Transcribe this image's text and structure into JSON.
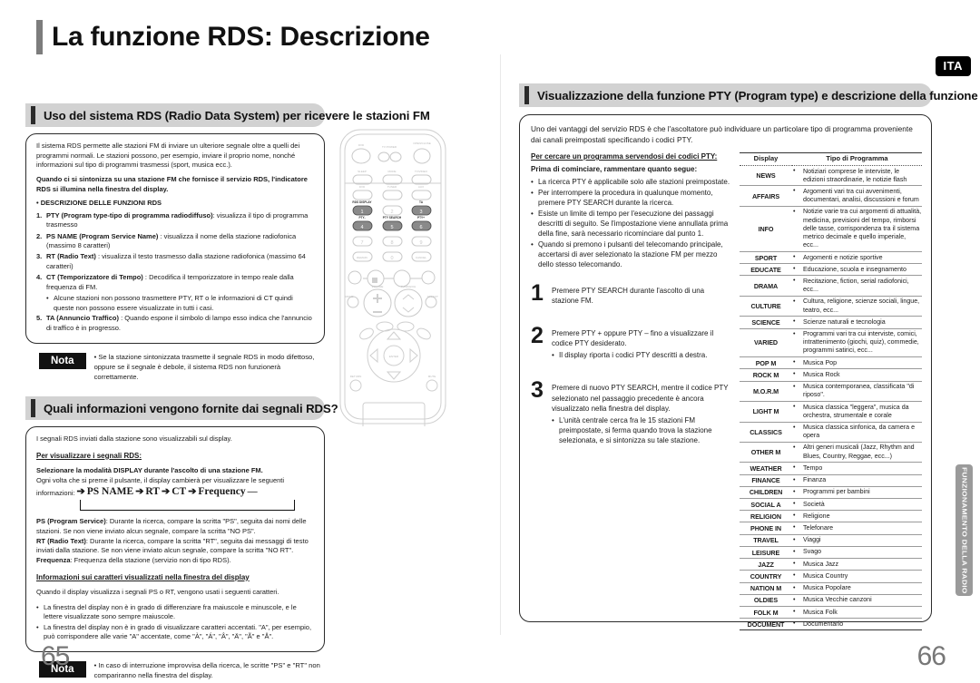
{
  "page": {
    "title": "La funzione RDS: Descrizione",
    "lang_badge": "ITA",
    "side_tab": "FUNZIONAMENTO DELLA RADIO",
    "page_number_left": "65",
    "page_number_right": "66"
  },
  "left": {
    "section1": {
      "heading": "Uso del sistema RDS (Radio Data System) per ricevere le stazioni FM",
      "intro": "Il sistema RDS permette alle stazioni FM di inviare un ulteriore segnale oltre a quelli dei programmi normali. Le stazioni possono, per esempio, inviare il proprio nome, nonché informazioni sul tipo di programmi trasmessi (sport, musica ecc.).",
      "bold_note": "Quando ci si sintonizza su una stazione FM che fornisce il servizio RDS, l'indicatore RDS si illumina nella finestra del display.",
      "list_title": "• DESCRIZIONE DELLE FUNZIONI RDS",
      "items": [
        {
          "n": "1.",
          "bold": "PTY (Program type-tipo di programma radiodiffuso)",
          "rest": ": visualizza il tipo di programma trasmesso"
        },
        {
          "n": "2.",
          "bold": "PS NAME (Program Service Name)",
          "rest": " : visualizza il nome della stazione radiofonica (massimo 8 caratteri)"
        },
        {
          "n": "3.",
          "bold": "RT (Radio Text)",
          "rest": " : visualizza il testo trasmesso dalla stazione radiofonica (massimo 64 caratteri)"
        },
        {
          "n": "4.",
          "bold": "CT (Temporizzatore di Tempo)",
          "rest": " : Decodifica il temporizzatore in tempo reale dalla frequenza di FM."
        }
      ],
      "sub_item": "Alcune stazioni non possono trasmettere PTY, RT o le informazioni di CT quindi queste non possono essere visualizzate in tutti i casi.",
      "item5": {
        "n": "5.",
        "bold": "TA (Annuncio Traffico)",
        "rest": " : Quando espone il simbolo di lampo esso indica che l'annuncio di traffico è in progresso."
      },
      "nota_label": "Nota",
      "nota_text": "• Se la stazione sintonizzata trasmette il segnale RDS in modo difettoso, oppure se il segnale è debole, il sistema RDS non funzionerà correttamente."
    },
    "section2": {
      "heading": "Quali informazioni vengono fornite dai segnali RDS?",
      "intro": "I segnali RDS inviati dalla stazione sono visualizzabili sul display.",
      "sub_heading": "Per visualizzare i segnali RDS:",
      "bold_line": "Selezionare la modalità DISPLAY durante l'ascolto di una stazione FM.",
      "line2": "Ogni volta che si preme il pulsante,  il display cambierà per visualizzare le seguenti",
      "line3": "informazioni:",
      "flow": [
        "PS NAME",
        "RT",
        "CT",
        "Frequency"
      ],
      "defs": [
        {
          "bold": "PS (Program Service)",
          "rest": ": Durante la ricerca, compare la scritta \"PS\", seguita dai nomi delle stazioni. Se non viene inviato alcun segnale, compare la scritta \"NO PS\"."
        },
        {
          "bold": "RT (Radio Text)",
          "rest": ": Durante la ricerca, compare la scritta \"RT\", seguita dai messaggi di testo inviati dalla stazione. Se non viene inviato alcun segnale, compare la scritta \"NO RT\"."
        },
        {
          "bold": "Frequenza",
          "rest": ": Frequenza della stazione (servizio non di tipo RDS)."
        }
      ],
      "chars_heading": "Informazioni sui caratteri visualizzati nella finestra del display",
      "chars_intro": "Quando il display visualizza i segnali PS o RT, vengono usati i seguenti caratteri.",
      "chars_bullets": [
        "La finestra del display non è in grado di differenziare fra maiuscole e minuscole, e le lettere visualizzate sono sempre maiuscole.",
        "La finestra del display non è in grado di visualizzare caratteri accentati. \"A\", per esempio, può corrispondere alle varie \"A\" accentate, come \"À\", \"Á\", \"Â\", \"Ä\", \"Ã\" e \"Å\"."
      ],
      "nota_label": "Nota",
      "nota_text": "• In caso di interruzione improvvisa della ricerca, le scritte \"PS\" e \"RT\" non compariranno nella finestra del display."
    }
  },
  "right": {
    "heading": "Visualizzazione della funzione PTY (Program type) e descrizione della funzione PTY-SEARCH",
    "intro": "Uno dei vantaggi del servizio RDS è che l'ascoltatore può individuare un particolare tipo di programma proveniente dai canali preimpostati specificando i codici PTY.",
    "search_heading": "Per cercare un programma servendosi dei codici PTY:",
    "before_heading": "Prima di cominciare, rammentare quanto segue:",
    "before_bullets": [
      "La ricerca PTY è applicabile solo alle stazioni preimpostate.",
      "Per interrompere la procedura in qualunque momento, premere PTY SEARCH durante la ricerca.",
      "Esiste un limite di tempo per l'esecuzione dei passaggi descritti di seguito. Se l'impostazione viene annullata prima della fine, sarà necessario ricominciare dal punto 1.",
      "Quando si premono i pulsanti del telecomando principale, accertarsi di aver selezionato la stazione FM per mezzo dello stesso telecomando."
    ],
    "steps": [
      {
        "n": "1",
        "text": "Premere PTY SEARCH durante l'ascolto di una stazione FM.",
        "sub": ""
      },
      {
        "n": "2",
        "text": "Premere PTY + oppure PTY – fino a visualizzare il codice PTY desiderato.",
        "sub": "Il display riporta i codici PTY descritti a destra."
      },
      {
        "n": "3",
        "text": "Premere di nuovo PTY SEARCH, mentre il codice PTY selezionato nel passaggio precedente è ancora visualizzato nella finestra del display.",
        "sub": "L'unità centrale cerca fra le 15 stazioni FM preimpostate, si ferma quando trova la stazione selezionata, e si sintonizza su tale stazione."
      }
    ],
    "table": {
      "col1": "Display",
      "col2": "Tipo di Programma",
      "rows": [
        {
          "code": "NEWS",
          "desc": "Notiziari comprese le interviste, le edizioni straordinarie, le notizie flash"
        },
        {
          "code": "AFFAIRS",
          "desc": "Argomenti vari tra cui avvenimenti, documentari, analisi, discussioni e forum"
        },
        {
          "code": "INFO",
          "desc": "Notizie varie tra cui argomenti di attualità, medicina, previsioni del tempo, rimborsi delle tasse, corrispondenza tra il sistema  metrico decimale e quello imperiale, ecc..."
        },
        {
          "code": "SPORT",
          "desc": "Argomenti e notizie sportive"
        },
        {
          "code": "EDUCATE",
          "desc": "Educazione, scuola e insegnamento"
        },
        {
          "code": "DRAMA",
          "desc": "Recitazione, fiction, serial radiofonici, ecc..."
        },
        {
          "code": "CULTURE",
          "desc": "Cultura, religione, scienze sociali, lingue, teatro, ecc..."
        },
        {
          "code": "SCIENCE",
          "desc": "Scienze naturali e tecnologia"
        },
        {
          "code": "VARIED",
          "desc": "Programmi vari tra cui interviste, comici, intrattenimento (giochi, quiz), commedie, programmi satirici, ecc..."
        },
        {
          "code": "POP M",
          "desc": "Musica Pop"
        },
        {
          "code": "ROCK M",
          "desc": "Musica Rock"
        },
        {
          "code": "M.O.R.M",
          "desc": "Musica contemporanea, classificata \"di riposo\"."
        },
        {
          "code": "LIGHT M",
          "desc": "Musica classica \"leggera\", musica da orchestra, strumentale e corale"
        },
        {
          "code": "CLASSICS",
          "desc": "Musica classica sinfonica, da camera e opera"
        },
        {
          "code": "OTHER M",
          "desc": "Altri generi musicali (Jazz, Rhythm and Blues, Country, Reggae, ecc...)"
        },
        {
          "code": "WEATHER",
          "desc": "Tempo"
        },
        {
          "code": "FINANCE",
          "desc": "Finanza"
        },
        {
          "code": "CHILDREN",
          "desc": "Programmi per bambini"
        },
        {
          "code": "SOCIAL A",
          "desc": "Società"
        },
        {
          "code": "RELIGION",
          "desc": "Religione"
        },
        {
          "code": "PHONE IN",
          "desc": "Telefonare"
        },
        {
          "code": "TRAVEL",
          "desc": "Viaggi"
        },
        {
          "code": "LEISURE",
          "desc": "Svago"
        },
        {
          "code": "JAZZ",
          "desc": "Musica Jazz"
        },
        {
          "code": "COUNTRY",
          "desc": "Musica Country"
        },
        {
          "code": "NATION M",
          "desc": "Musica Popolare"
        },
        {
          "code": "OLDIES",
          "desc": "Musica Vecchie canzoni"
        },
        {
          "code": "FOLK M",
          "desc": "Musica Folk"
        },
        {
          "code": "DOCUMENT",
          "desc": "Documentario"
        }
      ]
    }
  },
  "remote": {
    "labels": {
      "dvd": "DVD",
      "tv_power": "TV    POWER",
      "open_close": "OPEN/CLOSE",
      "sleep": "SLEEP",
      "mode": "MODE",
      "tv_video": "TV/VIDEO",
      "tuner": "TUNER",
      "aux": "AUX",
      "rds_display": "RDS DISPLAY",
      "ta": "TA",
      "pty_minus": "PTY-",
      "pty_search": "PTY SEARCH",
      "pty_plus": "PTY+",
      "remain": "REMAIN",
      "cancel": "CANCEL",
      "volume": "VOLUME",
      "tuning": "TUNING/CH",
      "return": "RETURN",
      "mute": "MUTE",
      "enter": "ENTER"
    }
  }
}
